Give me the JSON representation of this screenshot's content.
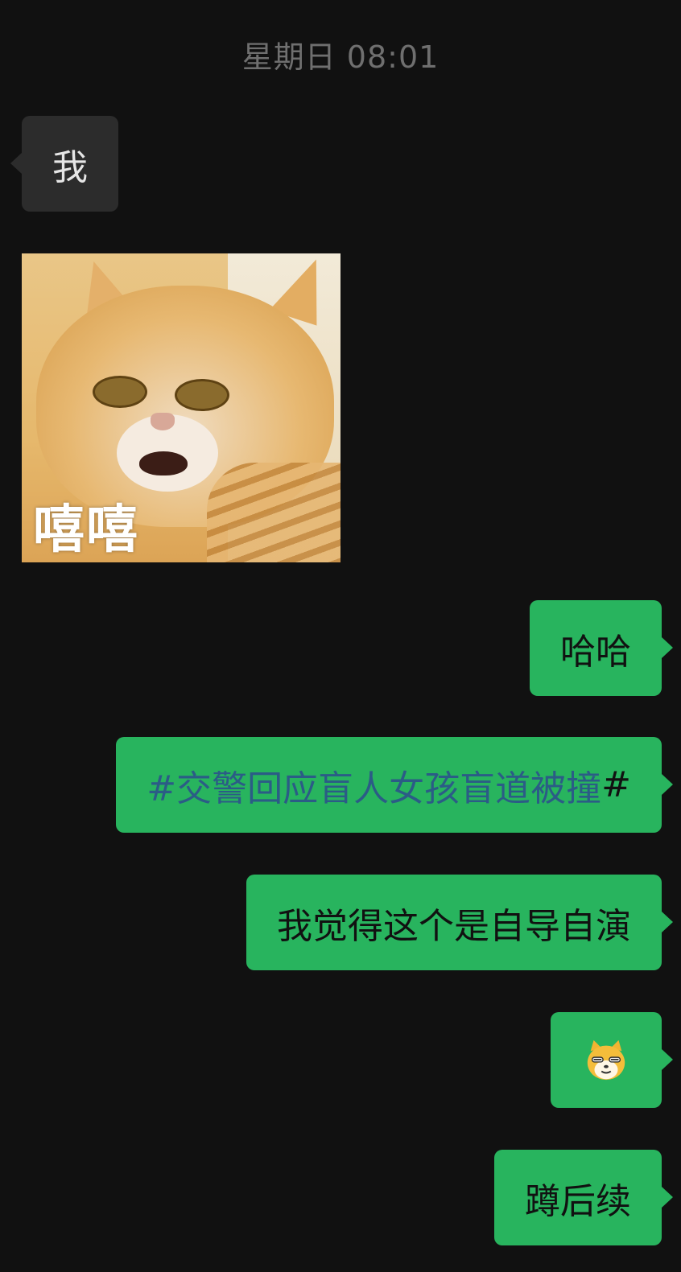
{
  "timestamp": "星期日 08:01",
  "messages": [
    {
      "side": "left",
      "type": "text",
      "text": "我"
    },
    {
      "side": "left",
      "type": "sticker",
      "icon": "cat-sticker-icon",
      "caption": "嘻嘻"
    },
    {
      "side": "right",
      "type": "text",
      "text": "哈哈"
    },
    {
      "side": "right",
      "type": "topic",
      "topic": "#交警回应盲人女孩盲道被撞",
      "suffix": "#"
    },
    {
      "side": "right",
      "type": "text",
      "text": "我觉得这个是自导自演"
    },
    {
      "side": "right",
      "type": "emoji",
      "icon": "smug-dog-emoji-icon"
    },
    {
      "side": "right",
      "type": "text",
      "text": "蹲后续"
    }
  ],
  "colors": {
    "background": "#111111",
    "bubble_incoming": "#2c2c2c",
    "bubble_outgoing": "#28b45e",
    "topic_link": "#2b5c86",
    "timestamp_text": "#6f6f6f"
  }
}
